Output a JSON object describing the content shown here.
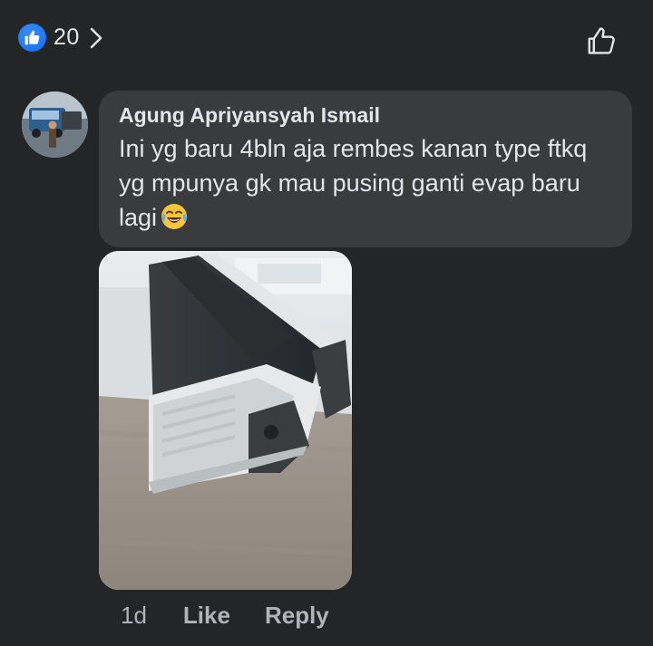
{
  "reactions": {
    "count": "20",
    "icon": "like-reaction-icon",
    "accent_color": "#1877f2"
  },
  "comment": {
    "author": "Agung Apriyansyah Ismail",
    "text": "Ini yg baru 4bln aja rembes kanan type ftkq yg mpunya gk mau pusing ganti evap baru lagi",
    "emoji": "laughing-crying-emoji",
    "attachment": "photo of air conditioner indoor unit",
    "time": "1d",
    "like_label": "Like",
    "reply_label": "Reply"
  },
  "colors": {
    "background": "#242526",
    "bubble": "#3a3b3c",
    "primary_text": "#e4e6eb",
    "secondary_text": "#b0b3b8"
  }
}
